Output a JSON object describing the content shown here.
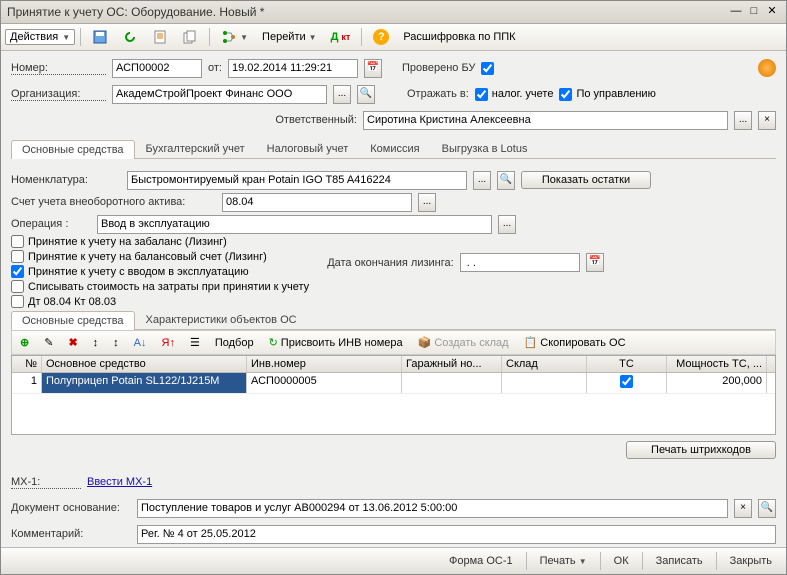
{
  "window": {
    "title": "Принятие к учету ОС: Оборудование. Новый *"
  },
  "toolbar": {
    "actions": "Действия",
    "goto": "Перейти",
    "decode": "Расшифровка по ППК"
  },
  "header": {
    "number_label": "Номер:",
    "number": "АСП00002",
    "from_label": "от:",
    "date": "19.02.2014 11:29:21",
    "checked_bu": "Проверено БУ",
    "org_label": "Организация:",
    "org": "АкадемСтройПроект Финанс ООО",
    "reflect_label": "Отражать в:",
    "nalog": "налог. учете",
    "upr": "По управлению",
    "resp_label": "Ответственный:",
    "resp": "Сиротина Кристина Алексеевна"
  },
  "tabs_main": [
    "Основные средства",
    "Бухгалтерский учет",
    "Налоговый учет",
    "Комиссия",
    "Выгрузка в Lotus"
  ],
  "main": {
    "nomen_label": "Номенклатура:",
    "nomen": "Быстромонтируемый кран Potain IGO T85 A416224",
    "show_balance": "Показать остатки",
    "account_label": "Счет учета внеоборотного актива:",
    "account": "08.04",
    "operation_label": "Операция :",
    "operation": "Ввод в эксплуатацию",
    "cb1": "Принятие к учету на забаланс (Лизинг)",
    "cb2": "Принятие к учету на балансовый счет (Лизинг)",
    "cb3": "Принятие к учету с вводом в эксплуатацию",
    "cb4": "Списывать стоимость на затраты при принятии к учету",
    "cb5": "Дт 08.04 Кт 08.03",
    "leasing_end": "Дата окончания лизинга:",
    "leasing_date": " . ."
  },
  "tabs_sub": [
    "Основные средства",
    "Характеристики объектов ОС"
  ],
  "subtoolbar": {
    "select": "Подбор",
    "assign_inv": "Присвоить ИНВ номера",
    "create_warehouse": "Создать склад",
    "copy_os": "Скопировать ОС"
  },
  "grid": {
    "headers": {
      "n": "№",
      "os": "Основное средство",
      "inv": "Инв.номер",
      "gar": "Гаражный но...",
      "skl": "Склад",
      "tc": "ТС",
      "pow": "Мощность ТС, ..."
    },
    "rows": [
      {
        "n": "1",
        "os": "Полуприцеп Potain SL122/1J215M",
        "inv": "АСП0000005",
        "gar": "",
        "skl": "",
        "tc": true,
        "pow": "200,000"
      }
    ]
  },
  "below_grid": {
    "print_barcodes": "Печать штрихкодов"
  },
  "bottom": {
    "mx1_label": "МХ-1:",
    "mx1_link": "Ввести МХ-1",
    "doc_base_label": "Документ основание:",
    "doc_base": "Поступление товаров и услуг АВ000294 от 13.06.2012 5:00:00",
    "comment_label": "Комментарий:",
    "comment": "Рег. № 4 от 25.05.2012"
  },
  "footer": {
    "form": "Форма ОС-1",
    "print": "Печать",
    "ok": "ОК",
    "save": "Записать",
    "close": "Закрыть"
  }
}
